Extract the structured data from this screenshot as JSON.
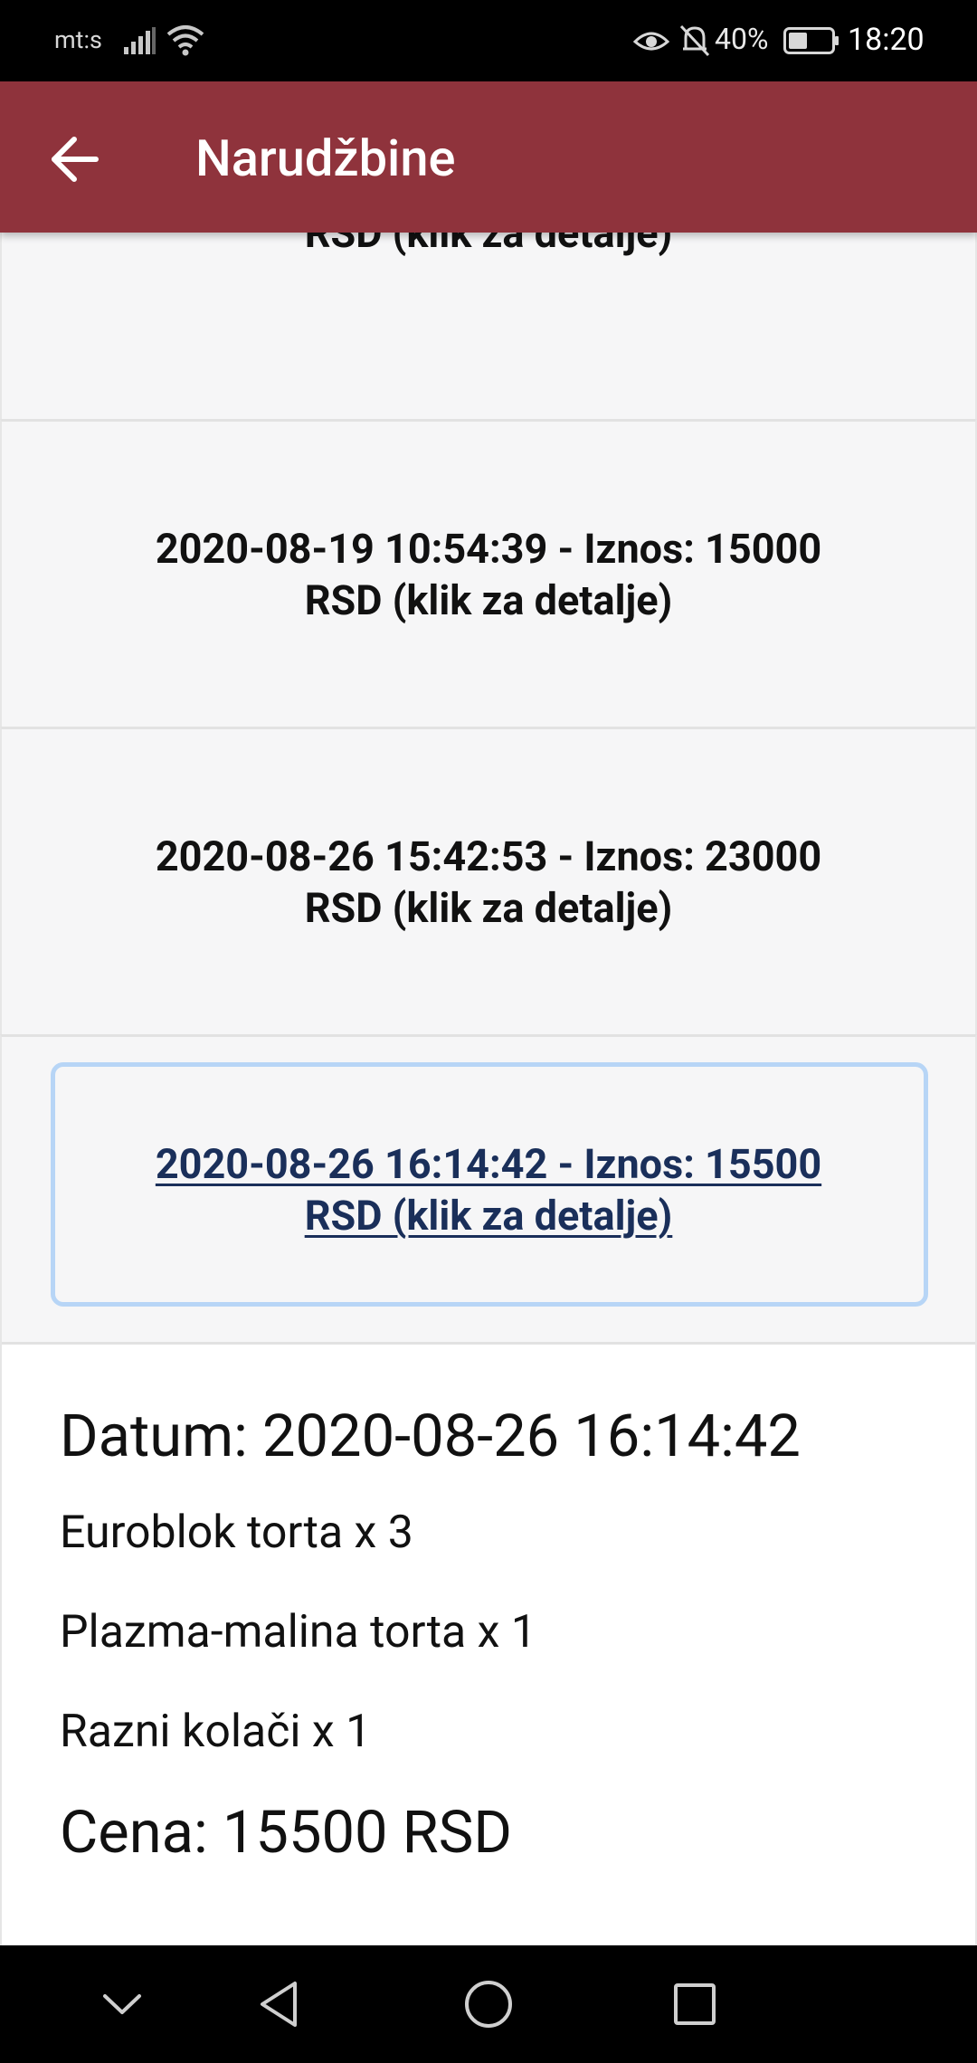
{
  "status_bar": {
    "carrier": "mt:s",
    "battery": "40%",
    "time": "18:20"
  },
  "app_bar": {
    "title": "Narudžbine"
  },
  "orders": [
    {
      "label": "RSD (klik za detalje)"
    },
    {
      "label": "2020-08-19 10:54:39 - Iznos: 15000 RSD (klik za detalje)"
    },
    {
      "label": "2020-08-26 15:42:53 - Iznos: 23000 RSD (klik za detalje)"
    },
    {
      "label": "2020-08-26 16:14:42 - Iznos: 15500 RSD (klik za detalje)"
    }
  ],
  "details": {
    "date_line": "Datum: 2020-08-26 16:14:42",
    "items": [
      "Euroblok torta x 3",
      "Plazma-malina torta x 1",
      "Razni kolači x 1"
    ],
    "price_line": "Cena: 15500 RSD"
  },
  "icons": {
    "back": "arrow-left-icon",
    "nav_down": "chevron-down-icon",
    "nav_back": "triangle-back-icon",
    "nav_home": "circle-home-icon",
    "nav_recent": "square-recents-icon"
  },
  "colors": {
    "app_bar": "#8f333c",
    "focus_ring": "#b7d5f6"
  }
}
